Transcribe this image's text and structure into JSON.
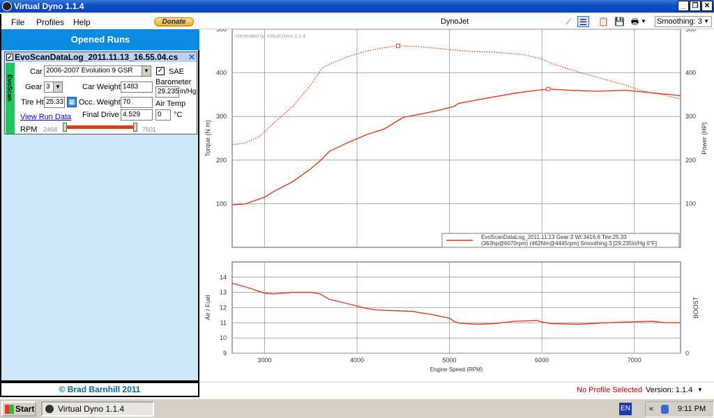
{
  "window": {
    "title": "Virtual Dyno 1.1.4"
  },
  "menu": {
    "items": [
      "File",
      "Profiles",
      "Help"
    ],
    "donate_label": "Donate"
  },
  "left": {
    "header": "Opened Runs",
    "run": {
      "name": "EvoScanDataLog_2011.11.13_16.55.04.cs",
      "tab_label": "EvoScan",
      "car_label": "Car",
      "car_value": "2006-2007 Evolution 9 GSR",
      "sae_label": "SAE",
      "gear_label": "Gear",
      "gear_value": "3",
      "car_weight_label": "Car Weight",
      "car_weight_value": "1483",
      "barometer_label": "Barometer",
      "barometer_value": "29.235",
      "barometer_unit": "in/Hg",
      "tire_label": "Tire Ht",
      "tire_value": "25.33",
      "occ_label": "Occ. Weight",
      "occ_value": "70",
      "air_temp_label": "Air Temp",
      "air_temp_value": "0",
      "air_temp_unit": "°C",
      "view_run_data": "View Run Data",
      "final_drive_label": "Final Drive",
      "final_drive_value": "4.529",
      "rpm_label": "RPM",
      "rpm_min": "2468",
      "rpm_max": "7501"
    },
    "footer": "© Brad Barnhill 2011"
  },
  "right": {
    "chart_title": "DynoJet",
    "smoothing_label": "Smoothing: 3",
    "status_text": "No Profile Selected",
    "version_text": "Version: 1.1.4"
  },
  "taskbar": {
    "start": "Start",
    "app": "Virtual Dyno 1.1.4",
    "lang": "EN",
    "time": "9:11 PM"
  },
  "colors": {
    "series": "#e23b1a",
    "header_blue": "#0a8ae0",
    "panel_bg": "#cde7fb"
  },
  "chart_data": [
    {
      "type": "line",
      "title": "DynoJet",
      "watermark": "Generated by Virtual Dyno 1.1.4",
      "xlabel": "",
      "ylabel": "Torque (N m)",
      "y2label": "Power (HP)",
      "xlim": [
        2650,
        7500
      ],
      "ylim": [
        0,
        500
      ],
      "y2lim": [
        0,
        500
      ],
      "yticks": [
        100,
        200,
        300,
        400,
        500
      ],
      "y2ticks": [
        100,
        200,
        300,
        400,
        500
      ],
      "grid": true,
      "legend_placement": "bottom-right",
      "legend": [
        "EvoScanDataLog_2011.11.13 Gear:3 Wt:3416.6 Tire:25.33",
        "(363hp@6070rpm) (462Nm@4445rpm) Smoothing:3 [29.235in/Hg 0°F]"
      ],
      "series": [
        {
          "name": "Power (HP)",
          "style": "solid",
          "axis": "y2",
          "x": [
            2650,
            2800,
            3000,
            3100,
            3300,
            3500,
            3620,
            3700,
            3900,
            4100,
            4300,
            4400,
            4500,
            4700,
            4900,
            5050,
            5100,
            5400,
            5700,
            5900,
            6070,
            6300,
            6600,
            6900,
            7200,
            7500
          ],
          "y": [
            97,
            100,
            115,
            128,
            150,
            180,
            202,
            220,
            240,
            258,
            272,
            285,
            298,
            306,
            315,
            323,
            330,
            342,
            353,
            359,
            363,
            360,
            358,
            360,
            354,
            348
          ]
        },
        {
          "name": "Torque (N m)",
          "style": "dotted",
          "axis": "y",
          "x": [
            2650,
            2800,
            2950,
            3100,
            3300,
            3500,
            3620,
            3700,
            3900,
            4100,
            4300,
            4445,
            4600,
            4800,
            5000,
            5200,
            5500,
            5800,
            6000,
            6100,
            6300,
            6600,
            6900,
            7100,
            7300,
            7500
          ],
          "y": [
            235,
            240,
            255,
            285,
            322,
            372,
            410,
            420,
            437,
            450,
            458,
            462,
            461,
            458,
            453,
            450,
            447,
            442,
            432,
            422,
            408,
            390,
            372,
            358,
            350,
            340
          ]
        }
      ],
      "markers": [
        {
          "x": 4445,
          "y": 462,
          "axis": "y"
        },
        {
          "x": 6070,
          "y": 363,
          "axis": "y2"
        }
      ]
    },
    {
      "type": "line",
      "xlabel": "Engine Speed (RPM)",
      "ylabel": "Air / Fuel",
      "y2label": "BOOST",
      "xlim": [
        2650,
        7500
      ],
      "ylim": [
        9,
        15
      ],
      "yticks": [
        9,
        10,
        11,
        12,
        13,
        14
      ],
      "y2ticks": [
        0
      ],
      "xticks": [
        3000,
        4000,
        5000,
        6000,
        7000
      ],
      "grid": true,
      "series": [
        {
          "name": "Air / Fuel",
          "style": "solid",
          "x": [
            2650,
            2800,
            3000,
            3100,
            3300,
            3500,
            3600,
            3700,
            3900,
            4100,
            4200,
            4400,
            4600,
            4800,
            5000,
            5050,
            5100,
            5300,
            5500,
            5700,
            5950,
            6000,
            6100,
            6400,
            6700,
            6900,
            7200,
            7350,
            7500
          ],
          "y": [
            13.6,
            13.35,
            12.95,
            12.9,
            13.0,
            13.0,
            12.9,
            12.55,
            12.25,
            11.95,
            11.85,
            11.8,
            11.75,
            11.55,
            11.3,
            11.1,
            10.98,
            10.9,
            10.95,
            11.1,
            11.15,
            11.05,
            10.95,
            10.9,
            11.0,
            11.05,
            11.1,
            11.0,
            11.0
          ]
        }
      ]
    }
  ]
}
